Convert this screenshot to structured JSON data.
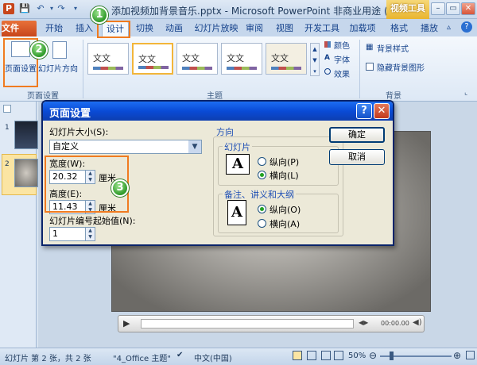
{
  "window": {
    "title": "添加视频加背景音乐.pptx - Microsoft PowerPoint 非商业用途 (试用版)",
    "context_tab": "视频工具"
  },
  "tabs": {
    "file": "文件",
    "start": "开始",
    "insert": "插入",
    "design": "设计",
    "transitions": "切换",
    "animations": "动画",
    "slideshow": "幻灯片放映",
    "review": "审阅",
    "view": "视图",
    "developer": "开发工具",
    "addins": "加载项",
    "format": "格式",
    "playback": "播放"
  },
  "ribbon": {
    "page_setup_label": "页面设置",
    "orientation_label": "幻灯片方向",
    "group_page_setup": "页面设置",
    "group_themes": "主题",
    "theme_thumb_text": "文文",
    "colors": "颜色",
    "fonts": "字体",
    "effects": "效果",
    "bg_styles": "背景样式",
    "hide_bg": "隐藏背景图形",
    "group_background": "背景"
  },
  "slides_pane": {
    "num1": "1",
    "num2": "2"
  },
  "dialog": {
    "title": "页面设置",
    "help": "?",
    "close": "✕",
    "size_label": "幻灯片大小(S):",
    "size_value": "自定义",
    "width_label": "宽度(W):",
    "width_value": "20.32",
    "height_label": "高度(E):",
    "height_value": "11.43",
    "unit": "厘米",
    "start_label": "幻灯片编号起始值(N):",
    "start_value": "1",
    "orientation_title": "方向",
    "slides_group": "幻灯片",
    "notes_group": "备注、讲义和大纲",
    "portrait_p": "纵向(P)",
    "landscape_l": "横向(L)",
    "portrait_o": "纵向(O)",
    "landscape_a": "横向(A)",
    "page_glyph": "A",
    "ok": "确定",
    "cancel": "取消"
  },
  "media": {
    "time": "00:00.00"
  },
  "status": {
    "slide_info": "幻灯片 第 2 张，共 2 张",
    "theme": "\"4_Office 主题\"",
    "language": "中文(中国)",
    "zoom": "50%"
  },
  "callouts": {
    "one": "1",
    "two": "2",
    "three": "3"
  },
  "colors": {
    "callout_box": "#f07b20",
    "file_tab": "#d65b26",
    "dialog_title": "#0a4bd6"
  }
}
